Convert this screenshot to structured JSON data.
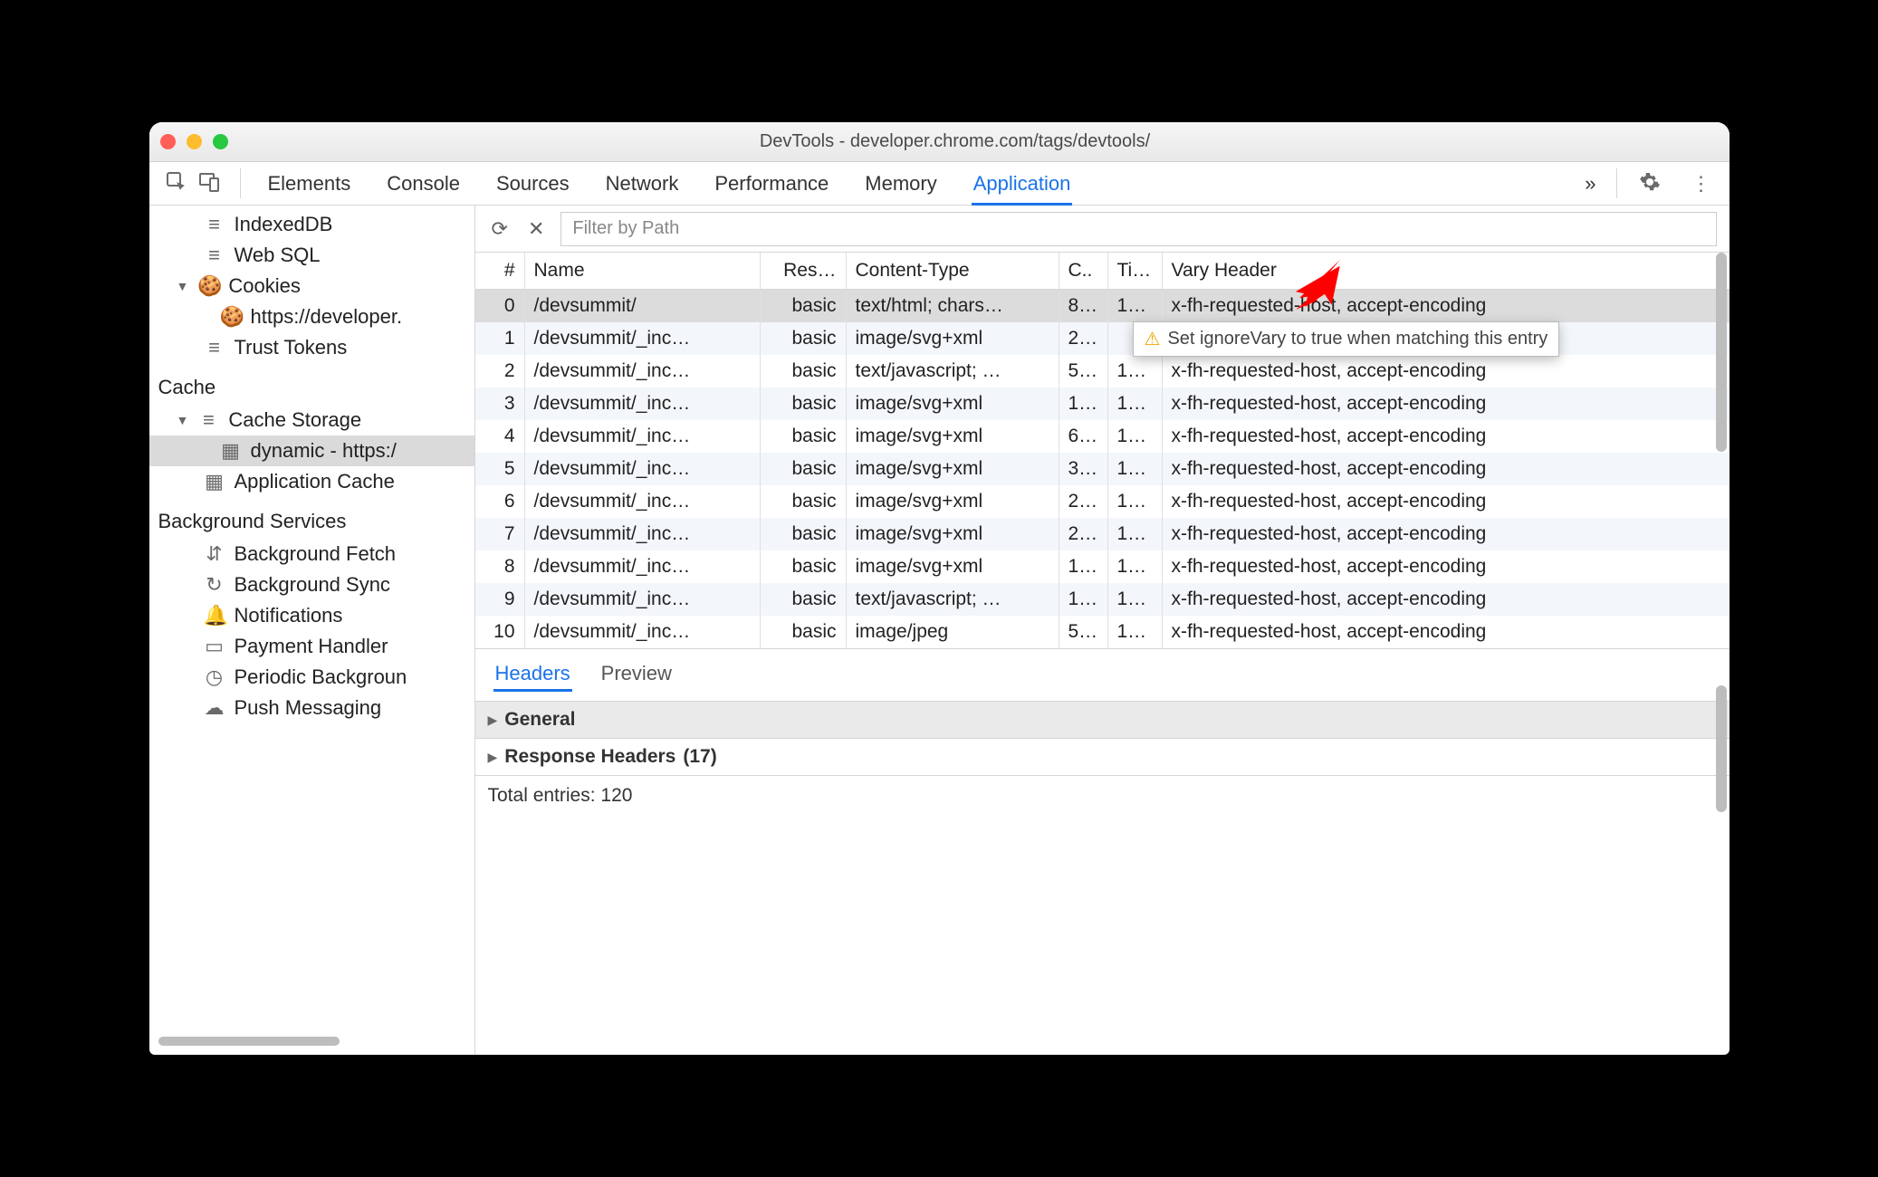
{
  "window": {
    "title": "DevTools - developer.chrome.com/tags/devtools/"
  },
  "tabs": {
    "items": [
      "Elements",
      "Console",
      "Sources",
      "Network",
      "Performance",
      "Memory",
      "Application"
    ],
    "active": "Application",
    "overflow": "»"
  },
  "sidebar": {
    "items": [
      {
        "kind": "item",
        "icon": "db",
        "label": "IndexedDB",
        "indent": 2,
        "expander": ""
      },
      {
        "kind": "item",
        "icon": "db",
        "label": "Web SQL",
        "indent": 2,
        "expander": ""
      },
      {
        "kind": "item",
        "icon": "cookie",
        "label": "Cookies",
        "indent": 1,
        "expander": "▼"
      },
      {
        "kind": "item",
        "icon": "cookie",
        "label": "https://developer.",
        "indent": 3,
        "expander": ""
      },
      {
        "kind": "item",
        "icon": "db",
        "label": "Trust Tokens",
        "indent": 2,
        "expander": ""
      },
      {
        "kind": "section",
        "label": "Cache"
      },
      {
        "kind": "item",
        "icon": "db",
        "label": "Cache Storage",
        "indent": 1,
        "expander": "▼"
      },
      {
        "kind": "item",
        "icon": "grid",
        "label": "dynamic - https:/",
        "indent": 3,
        "expander": "",
        "selected": true
      },
      {
        "kind": "item",
        "icon": "grid",
        "label": "Application Cache",
        "indent": 2,
        "expander": ""
      },
      {
        "kind": "section",
        "label": "Background Services"
      },
      {
        "kind": "item",
        "icon": "updown",
        "label": "Background Fetch",
        "indent": 2
      },
      {
        "kind": "item",
        "icon": "sync",
        "label": "Background Sync",
        "indent": 2
      },
      {
        "kind": "item",
        "icon": "bell",
        "label": "Notifications",
        "indent": 2
      },
      {
        "kind": "item",
        "icon": "card",
        "label": "Payment Handler",
        "indent": 2
      },
      {
        "kind": "item",
        "icon": "clock",
        "label": "Periodic Backgroun",
        "indent": 2
      },
      {
        "kind": "item",
        "icon": "cloud",
        "label": "Push Messaging",
        "indent": 2
      }
    ]
  },
  "toolbar": {
    "filter_placeholder": "Filter by Path"
  },
  "grid": {
    "headers": [
      "#",
      "Name",
      "Res…",
      "Content-Type",
      "C..",
      "Ti…",
      "Vary Header"
    ],
    "rows": [
      {
        "n": "0",
        "name": "/devsummit/",
        "res": "basic",
        "ct": "text/html; chars…",
        "c": "8…",
        "t": "1…",
        "vary": "x-fh-requested-host, accept-encoding",
        "selected": true
      },
      {
        "n": "1",
        "name": "/devsummit/_inc…",
        "res": "basic",
        "ct": "image/svg+xml",
        "c": "2…",
        "t": "",
        "vary": ""
      },
      {
        "n": "2",
        "name": "/devsummit/_inc…",
        "res": "basic",
        "ct": "text/javascript; …",
        "c": "5…",
        "t": "1…",
        "vary": "x-fh-requested-host, accept-encoding"
      },
      {
        "n": "3",
        "name": "/devsummit/_inc…",
        "res": "basic",
        "ct": "image/svg+xml",
        "c": "1…",
        "t": "1…",
        "vary": "x-fh-requested-host, accept-encoding"
      },
      {
        "n": "4",
        "name": "/devsummit/_inc…",
        "res": "basic",
        "ct": "image/svg+xml",
        "c": "6…",
        "t": "1…",
        "vary": "x-fh-requested-host, accept-encoding"
      },
      {
        "n": "5",
        "name": "/devsummit/_inc…",
        "res": "basic",
        "ct": "image/svg+xml",
        "c": "3…",
        "t": "1…",
        "vary": "x-fh-requested-host, accept-encoding"
      },
      {
        "n": "6",
        "name": "/devsummit/_inc…",
        "res": "basic",
        "ct": "image/svg+xml",
        "c": "2…",
        "t": "1…",
        "vary": "x-fh-requested-host, accept-encoding"
      },
      {
        "n": "7",
        "name": "/devsummit/_inc…",
        "res": "basic",
        "ct": "image/svg+xml",
        "c": "2…",
        "t": "1…",
        "vary": "x-fh-requested-host, accept-encoding"
      },
      {
        "n": "8",
        "name": "/devsummit/_inc…",
        "res": "basic",
        "ct": "image/svg+xml",
        "c": "1…",
        "t": "1…",
        "vary": "x-fh-requested-host, accept-encoding"
      },
      {
        "n": "9",
        "name": "/devsummit/_inc…",
        "res": "basic",
        "ct": "text/javascript; …",
        "c": "1…",
        "t": "1…",
        "vary": "x-fh-requested-host, accept-encoding"
      },
      {
        "n": "10",
        "name": "/devsummit/_inc…",
        "res": "basic",
        "ct": "image/jpeg",
        "c": "5…",
        "t": "1…",
        "vary": "x-fh-requested-host, accept-encoding"
      }
    ]
  },
  "tooltip": {
    "text": "Set ignoreVary to true when matching this entry"
  },
  "detail": {
    "tabs": [
      "Headers",
      "Preview"
    ],
    "active": "Headers",
    "sections": {
      "general": "General",
      "response": "Response Headers",
      "response_count": "(17)"
    },
    "footer": "Total entries: 120"
  }
}
